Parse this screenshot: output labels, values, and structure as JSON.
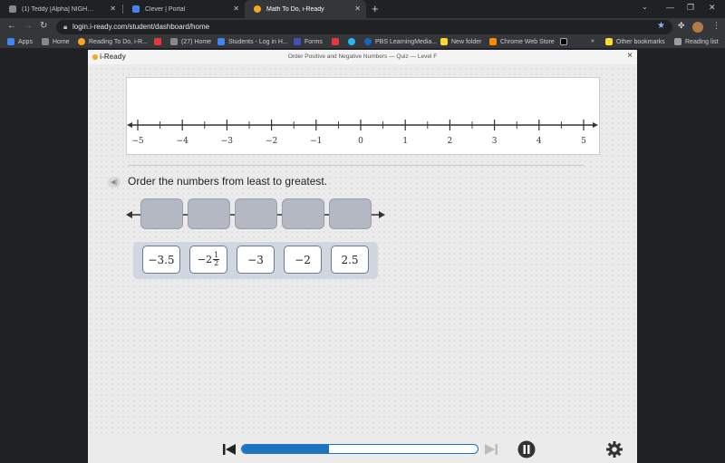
{
  "browser": {
    "tabs": [
      {
        "title": "(1) Teddy [Alpha] NIGHTMARE M...",
        "active": false,
        "favicon_color": "#888888"
      },
      {
        "title": "Clever | Portal",
        "active": false,
        "favicon_color": "#4285f4"
      },
      {
        "title": "Math To Do, i-Ready",
        "active": true,
        "favicon_color": "#f6a623"
      }
    ],
    "url": "login.i-ready.com/student/dashboard/home",
    "bookmarks": [
      {
        "label": "Apps",
        "color": "#4285f4"
      },
      {
        "label": "Home",
        "color": "#888888"
      },
      {
        "label": "Reading To Do, i-R...",
        "color": "#f6a623"
      },
      {
        "label": "",
        "color": "#e53935"
      },
      {
        "label": "(27) Home",
        "color": "#888888"
      },
      {
        "label": "Students - Log in H...",
        "color": "#4285f4"
      },
      {
        "label": "Forms",
        "color": "#3f51b5"
      },
      {
        "label": "",
        "color": "#e53935"
      },
      {
        "label": "",
        "color": "#29b6f6"
      },
      {
        "label": "PBS LearningMedia...",
        "color": "#1565c0"
      },
      {
        "label": "New folder",
        "color": "#fdd835"
      },
      {
        "label": "Chrome Web Store",
        "color": "#fb8c00"
      },
      {
        "label": "",
        "color": "#000000"
      },
      {
        "label": "Other bookmarks",
        "color": "#fdd835"
      },
      {
        "label": "Reading list",
        "color": "#9e9e9e"
      }
    ],
    "overflow_label": "»"
  },
  "lesson": {
    "logo": "i-Ready",
    "title": "Order Positive and Negative Numbers — Quiz — Level F",
    "close": "×",
    "prompt": "Order the numbers from least to greatest.",
    "number_line": {
      "min": -5,
      "max": 5,
      "labels": [
        "−5",
        "−4",
        "−3",
        "−2",
        "−1",
        "0",
        "1",
        "2",
        "3",
        "4",
        "5"
      ]
    },
    "answer_slots": 5,
    "cards": [
      {
        "value": "−3.5"
      },
      {
        "whole": "−2",
        "num": "1",
        "den": "2"
      },
      {
        "value": "−3"
      },
      {
        "value": "−2"
      },
      {
        "value": "2.5"
      }
    ],
    "progress": 0.37
  }
}
